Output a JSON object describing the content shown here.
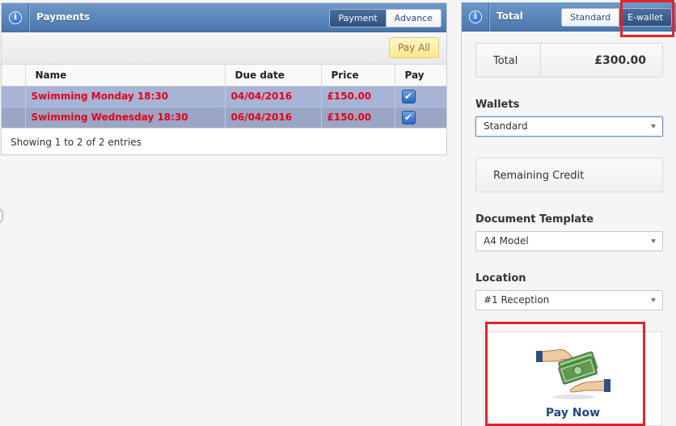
{
  "payments_panel": {
    "title": "Payments",
    "tabs": [
      "Payment",
      "Advance"
    ],
    "active_tab": "Payment",
    "pay_all_label": "Pay All",
    "columns": [
      "Name",
      "Due date",
      "Price",
      "Pay"
    ],
    "rows": [
      {
        "name": "Swimming Monday 18:30",
        "due_date": "04/04/2016",
        "price": "£150.00",
        "pay": true
      },
      {
        "name": "Swimming Wednesday 18:30",
        "due_date": "06/04/2016",
        "price": "£150.00",
        "pay": true
      }
    ],
    "footer": "Showing 1 to 2 of 2 entries"
  },
  "total_panel": {
    "title": "Total",
    "tabs": [
      "Standard",
      "E-wallet"
    ],
    "active_tab": "E-wallet",
    "total_label": "Total",
    "total_value": "£300.00",
    "wallets_label": "Wallets",
    "wallet_selected": "Standard",
    "remaining_credit_label": "Remaining Credit",
    "document_template_label": "Document Template",
    "document_template_selected": "A4 Model",
    "location_label": "Location",
    "location_selected": "#1 Reception",
    "pay_now_label": "Pay Now"
  },
  "colors": {
    "header_blue": "#4a77ad",
    "row_text_red": "#e8001c",
    "highlight_red": "#e0242a",
    "selected_row": "#a7b4d6"
  },
  "icons": [
    "info-icon",
    "checkbox-checked-icon",
    "money-hands-icon",
    "dropdown-arrow-icon"
  ]
}
